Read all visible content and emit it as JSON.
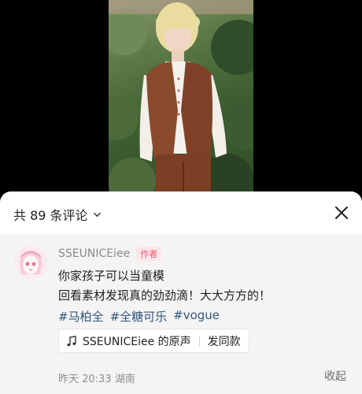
{
  "header": {
    "count_label": "共 89 条评论"
  },
  "comment": {
    "username": "SSEUNICEiee",
    "author_badge": "作者",
    "lines": [
      "你家孩子可以当童模",
      "回看素材发现真的劲劲滴！大大方方的！"
    ],
    "hashtags": [
      "#马柏全",
      "#全糖可乐",
      "#vogue"
    ],
    "sound": {
      "label": "SSEUNICEiee 的原声",
      "action": "发同款"
    },
    "meta": "昨天 20:33 湖南",
    "collapse_label": "收起"
  },
  "colors": {
    "hashtag": "#33557a",
    "badge_text": "#e8556f",
    "badge_bg": "#fde6ea",
    "sheet_bg": "#f4f4f4"
  },
  "icons": [
    "chevron-down-icon",
    "close-icon",
    "music-note-icon"
  ]
}
